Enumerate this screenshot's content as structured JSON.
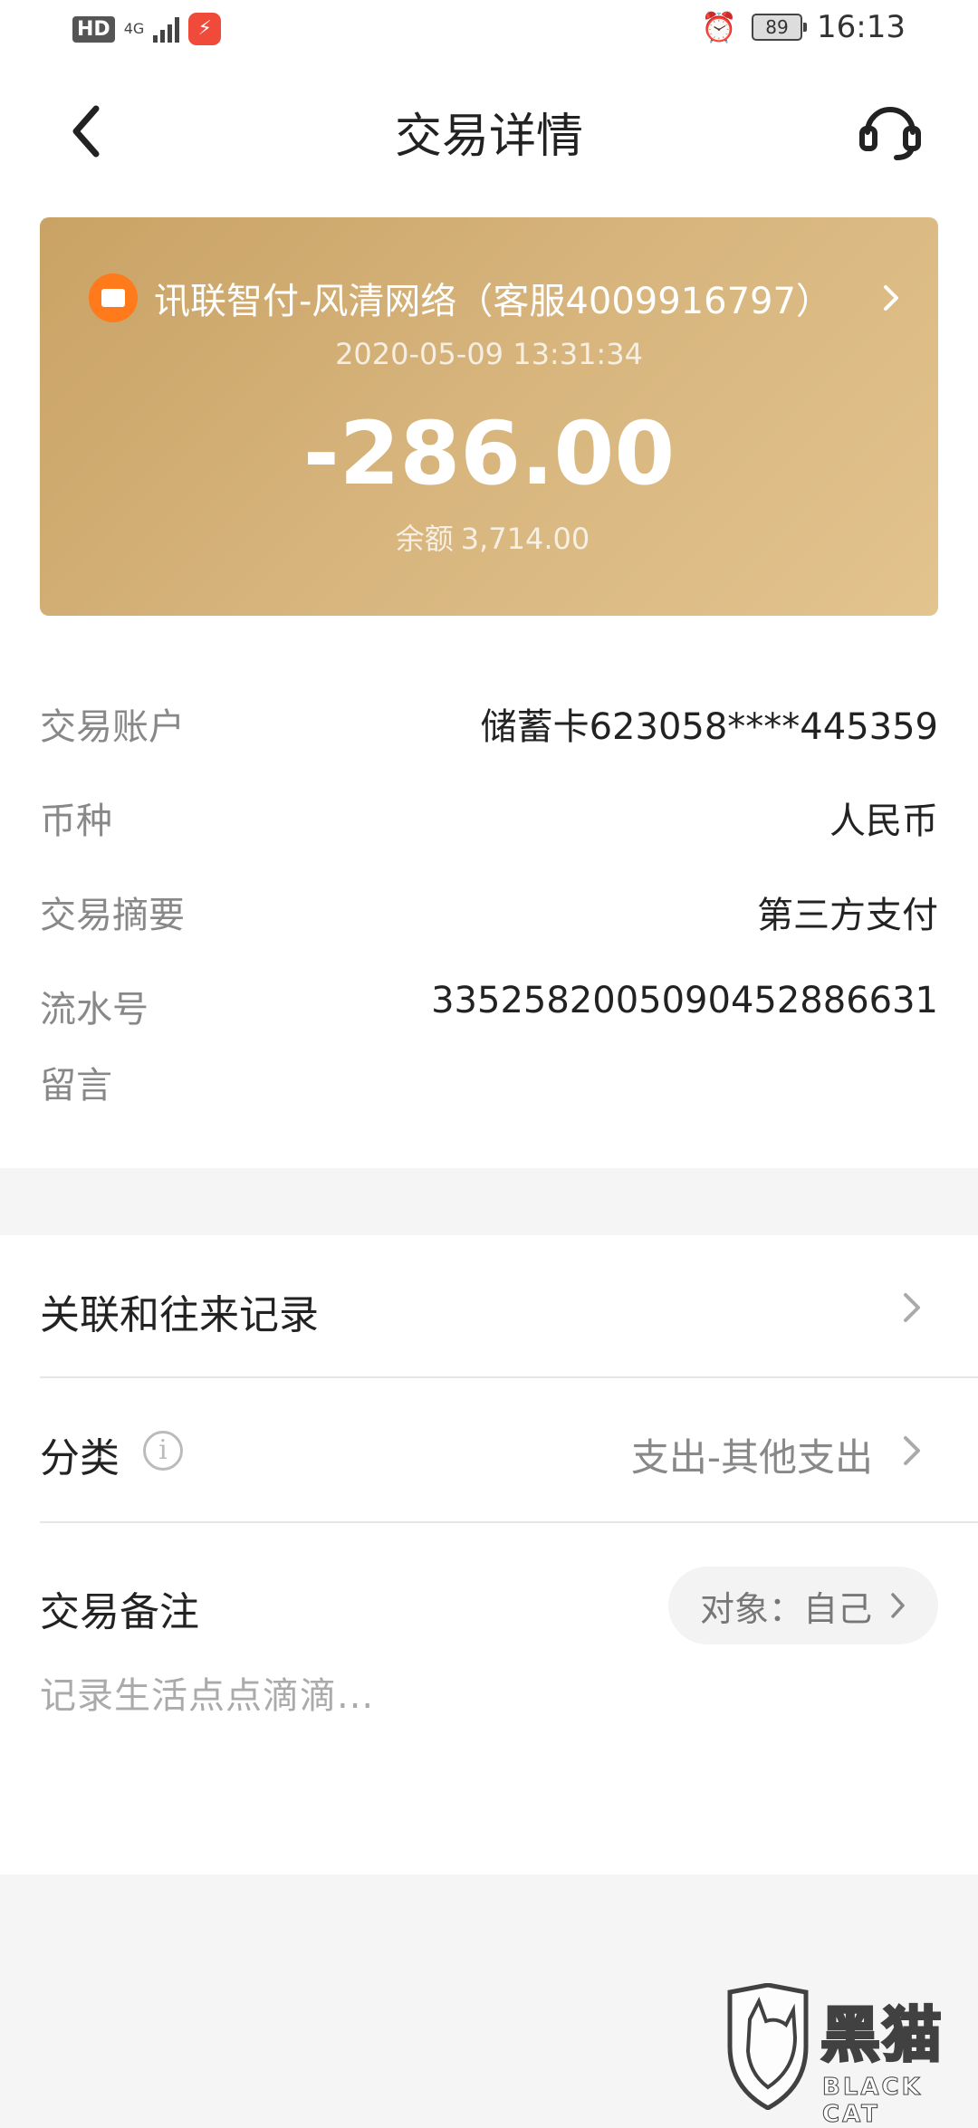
{
  "status_bar": {
    "hd": "HD",
    "network": "4G",
    "battery": "89",
    "time": "16:13"
  },
  "nav": {
    "title": "交易详情",
    "icons": {
      "back": "chevron-left-icon",
      "service": "headset-icon"
    }
  },
  "card": {
    "merchant": "讯联智付-风清网络（客服4009916797）",
    "datetime": "2020-05-09 13:31:34",
    "amount": "-286.00",
    "balance_label": "余额",
    "balance_value": "3,714.00"
  },
  "details": [
    {
      "label": "交易账户",
      "value": "储蓄卡623058****445359"
    },
    {
      "label": "币种",
      "value": "人民币"
    },
    {
      "label": "交易摘要",
      "value": "第三方支付"
    },
    {
      "label": "流水号",
      "value": "33525820050904528866 31"
    },
    {
      "label": "留言",
      "value": ""
    }
  ],
  "related": {
    "label": "关联和往来记录"
  },
  "category": {
    "label": "分类",
    "value": "支出-其他支出"
  },
  "remark": {
    "label": "交易备注",
    "target": "对象：自己",
    "placeholder": "记录生活点点滴滴..."
  },
  "watermark": {
    "cn": "黑猫",
    "en": "BLACK CAT"
  },
  "colors": {
    "card_gradient_start": "#c9a265",
    "card_gradient_end": "#e3c38e",
    "merchant_icon": "#ff7a1a"
  }
}
